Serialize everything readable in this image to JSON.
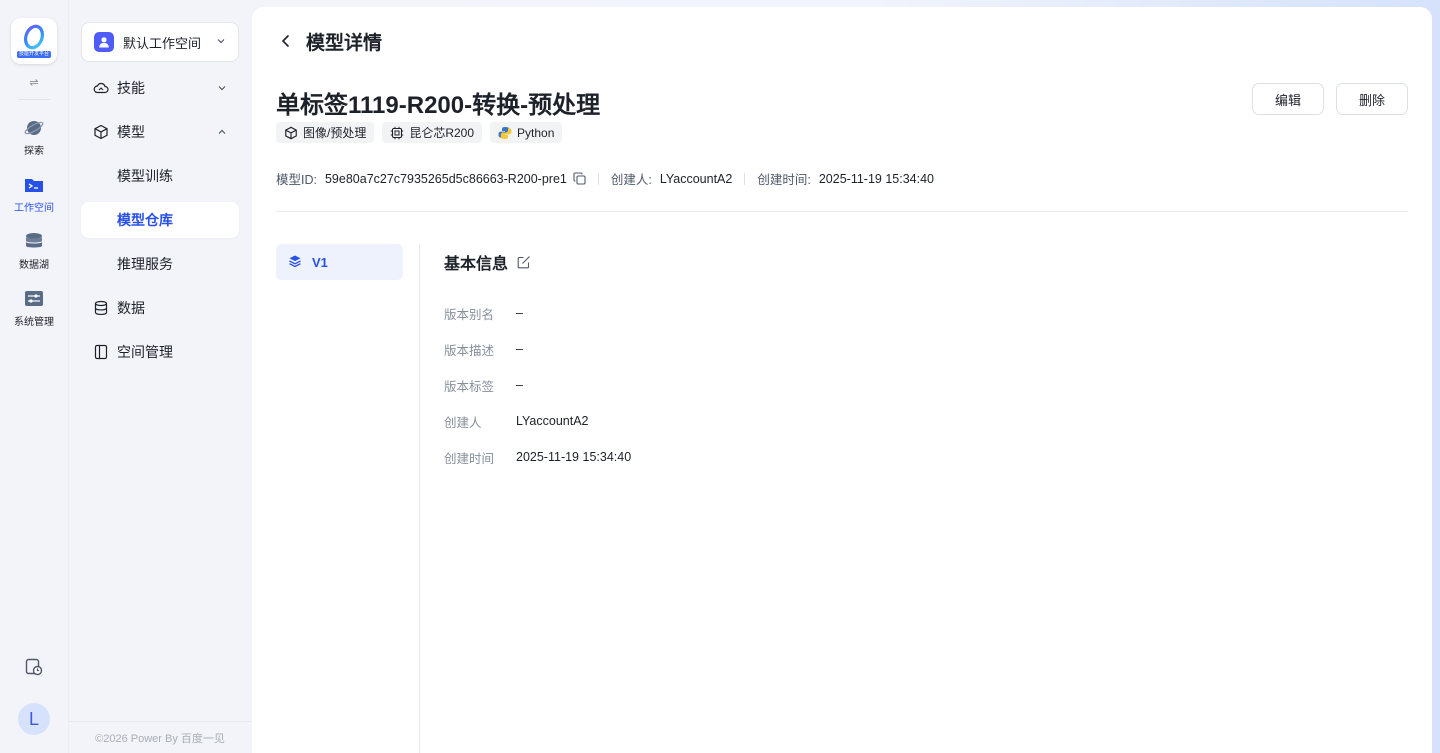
{
  "rail": {
    "logo_caption": "技能开发平台",
    "toggle_symbol": "⇌",
    "items": [
      {
        "label": "探索",
        "icon": "planet-icon"
      },
      {
        "label": "工作空间",
        "icon": "terminal-folder-icon"
      },
      {
        "label": "数据湖",
        "icon": "database-icon"
      },
      {
        "label": "系统管理",
        "icon": "settings-panel-icon"
      }
    ],
    "avatar_letter": "L"
  },
  "sidebar": {
    "workspace_name": "默认工作空间",
    "nav": [
      {
        "label": "技能",
        "icon": "cloud-icon"
      },
      {
        "label": "模型",
        "icon": "cube-icon"
      },
      {
        "label": "模型训练"
      },
      {
        "label": "模型仓库"
      },
      {
        "label": "推理服务"
      },
      {
        "label": "数据",
        "icon": "database-icon"
      },
      {
        "label": "空间管理",
        "icon": "book-icon"
      }
    ],
    "footer": "©2026 Power By 百度一见"
  },
  "header": {
    "title": "模型详情"
  },
  "model": {
    "name": "单标签1119-R200-转换-预处理",
    "tags": [
      {
        "label": "图像/预处理",
        "icon": "cube-icon"
      },
      {
        "label": "昆仑芯R200",
        "icon": "chip-icon"
      },
      {
        "label": "Python",
        "icon": "python-icon"
      }
    ],
    "id_label": "模型ID:",
    "id_value": "59e80a7c27c7935265d5c86663-R200-pre1",
    "creator_label": "创建人:",
    "creator_value": "LYaccountA2",
    "created_label": "创建时间:",
    "created_value": "2025-11-19 15:34:40"
  },
  "actions": {
    "edit": "编辑",
    "delete": "删除"
  },
  "versions": [
    {
      "label": "V1"
    }
  ],
  "basic_info": {
    "title": "基本信息",
    "rows": [
      {
        "label": "版本别名",
        "value": "–"
      },
      {
        "label": "版本描述",
        "value": "–"
      },
      {
        "label": "版本标签",
        "value": "–"
      },
      {
        "label": "创建人",
        "value": "LYaccountA2"
      },
      {
        "label": "创建时间",
        "value": "2025-11-19 15:34:40"
      }
    ]
  },
  "colors": {
    "accent": "#2850e6",
    "active_bg": "#eef2fd",
    "workspace_avatar": "#4f5cf7"
  }
}
